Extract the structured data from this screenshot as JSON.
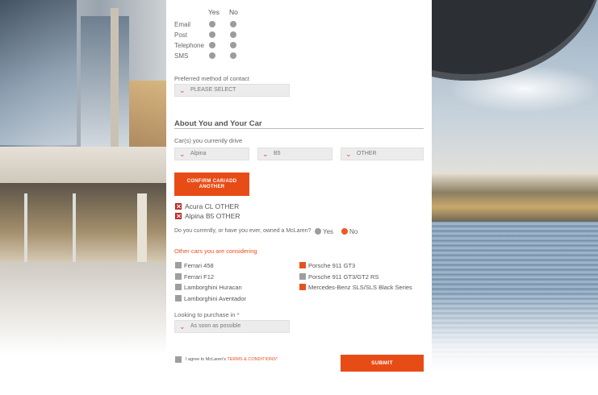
{
  "contact_preferences": {
    "columns": [
      "Yes",
      "No"
    ],
    "rows": [
      "Email",
      "Post",
      "Telephone",
      "SMS"
    ]
  },
  "preferred_method": {
    "label": "Preferred method of contact",
    "value": "PLEASE SELECT"
  },
  "about_section": {
    "heading": "About You and Your Car",
    "cars_label": "Car(s) you currently drive",
    "make": "Alpina",
    "model": "B5",
    "other": "OTHER",
    "confirm_button_line1": "CONFIRM CAR/ADD",
    "confirm_button_line2": "ANOTHER",
    "added_cars": [
      "Acura CL OTHER",
      "Alpina B5 OTHER"
    ]
  },
  "mclaren_owner": {
    "question": "Do you currently, or have you ever, owned a McLaren?",
    "yes": "Yes",
    "no": "No",
    "selected": "No"
  },
  "considering": {
    "label": "Other cars you are considering",
    "left_column": [
      {
        "label": "Ferrari 458",
        "checked": false
      },
      {
        "label": "Ferrari F12",
        "checked": false
      },
      {
        "label": "Lamborghini Huracan",
        "checked": false
      },
      {
        "label": "Lamborghini Aventador",
        "checked": false
      }
    ],
    "right_column": [
      {
        "label": "Porsche 911 GT3",
        "checked": true
      },
      {
        "label": "Porsche 911 GT3/GT2 RS",
        "checked": false
      },
      {
        "label": "Mercedes-Benz SLS/SLS Black Series",
        "checked": true
      }
    ]
  },
  "purchase": {
    "label": "Looking to purchase in",
    "required_mark": "*",
    "value": "As soon as possible"
  },
  "terms": {
    "prefix": "I agree to McLaren's ",
    "link": "TERMS & CONDITIONS",
    "required_mark": "*"
  },
  "submit_label": "SUBMIT",
  "colors": {
    "accent": "#e84c16",
    "radio_unselected": "#9c9c9c",
    "checkbox_unchecked": "#9e9e9e"
  }
}
